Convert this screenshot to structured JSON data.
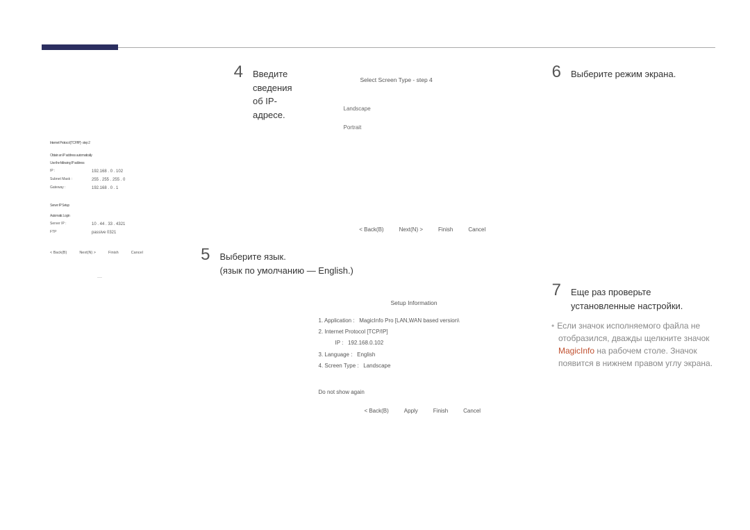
{
  "steps": {
    "s4": {
      "num": "4",
      "title": "Введите сведения об IP-адресе.",
      "wizard": {
        "title": "Internet Protocol [TCP/IP] - step 2",
        "auto_label": "Obtain an IP address automatically",
        "manual_label": "Use the following IP address",
        "ip_label": "IP :",
        "ip_value": "192.168 . 0 . 102",
        "subnet_label": "Subnet Mask :",
        "subnet_value": "255 . 255 . 255 . 0",
        "gateway_label": "Gateway :",
        "gateway_value": "192.168 . 0 . 1",
        "server_section": "Server IP Setup",
        "auto_login": "Automatic Login",
        "srv_ip_label": "Server IP :",
        "srv_ip_value": "10 . 44 . 33 . 4321",
        "ftp_label": "FTP",
        "ftp_value": "passive 0321",
        "back": "< Back(B)",
        "next": "Next(N) >",
        "finish": "Finish",
        "cancel": "Cancel"
      }
    },
    "s5": {
      "num": "5",
      "title_line1": "Выберите язык.",
      "title_line2": "(язык по умолчанию — English.)",
      "info": {
        "title": "Setup Information",
        "l1_label": "1. Application :",
        "l1_value": "MagicInfo Pro [LAN,WAN based version\\",
        "l2_label": "2. Internet Protocol [TCP/IP]",
        "ip_indent_label": "IP :",
        "ip_indent_value": "192.168.0.102",
        "l3_label": "3. Language :",
        "l3_value": "English",
        "l4_label": "4. Screen Type :",
        "l4_value": "Landscape",
        "checkbox": "Do not show again",
        "back": "< Back(B)",
        "apply": "Apply",
        "finish": "Finish",
        "cancel": "Cancel"
      }
    },
    "s6": {
      "num": "6",
      "title": "Выберите режим экрана.",
      "wizard": {
        "title": "Select Screen Type - step 4",
        "opt1": "Landscape",
        "opt2": "Portrait",
        "back": "< Back(B)",
        "next": "Next(N) >",
        "finish": "Finish",
        "cancel": "Cancel"
      }
    },
    "s7": {
      "num": "7",
      "title_line1": "Еще раз проверьте",
      "title_line2": "установленные настройки.",
      "note_prefix": "Если значок исполняемого файла не отобразился, дважды щелкните значок ",
      "note_red": "MagicInfo",
      "note_suffix": " на рабочем столе. Значок появится в нижнем правом углу экрана."
    }
  }
}
